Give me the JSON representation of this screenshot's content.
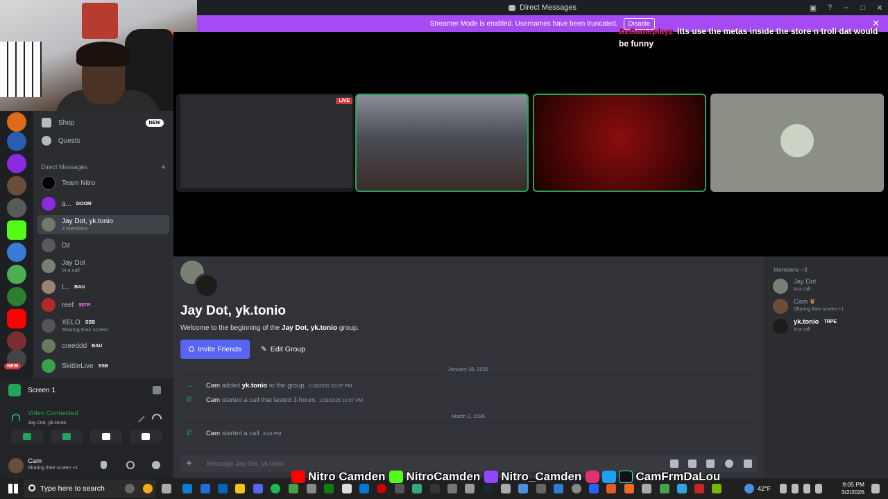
{
  "window": {
    "title": "Direct Messages"
  },
  "banner": {
    "text": "Streamer Mode is enabled. Usernames have been truncated.",
    "button": "Disable"
  },
  "stream_chat": {
    "user": "DzGameplayz",
    "message": "Itts use the metas inside the store n troll dat would be funny"
  },
  "sidebar": {
    "shop": "Shop",
    "shop_badge": "NEW",
    "quests": "Quests",
    "dm_header": "Direct Messages",
    "dms": [
      {
        "name": "Team Nitro",
        "sub": "",
        "tag": ""
      },
      {
        "name": "a...",
        "sub": "",
        "tag": "DOOM"
      },
      {
        "name": "Jay Dot, yk.tonio",
        "sub": "3 Members",
        "tag": ""
      },
      {
        "name": "Dz",
        "sub": "",
        "tag": ""
      },
      {
        "name": "Jay Dot",
        "sub": "In a call",
        "tag": ""
      },
      {
        "name": "t...",
        "sub": "",
        "tag": "BAU"
      },
      {
        "name": "reef",
        "sub": "",
        "tag": "$$TR"
      },
      {
        "name": "XELO",
        "sub": "Sharing their screen",
        "tag": "SSB"
      },
      {
        "name": "creeddd",
        "sub": "",
        "tag": "BAU"
      },
      {
        "name": "SkittleLive",
        "sub": "",
        "tag": "SSB"
      }
    ],
    "rail_badge": "NEW"
  },
  "panel": {
    "screen_label": "Screen 1",
    "vc_status": "Video Connected",
    "vc_channel": "Jay Dot, yk.tonio",
    "user_name": "Cam",
    "user_status": "Sharing their screen +1"
  },
  "call": {
    "live_badge": "LIVE"
  },
  "chat": {
    "group_title": "Jay Dot, yk.tonio",
    "welcome_prefix": "Welcome to the beginning of the ",
    "welcome_group": "Jay Dot, yk.tonio",
    "welcome_suffix": " group.",
    "invite_button": "Invite Friends",
    "edit_button": "Edit Group",
    "date1": "January 18, 2026",
    "msg1_user": "Cam",
    "msg1_text1": " added ",
    "msg1_target": "yk.tonio",
    "msg1_text2": " to the group.",
    "msg1_ts": "1/18/2026 10:07 PM",
    "msg2_user": "Cam",
    "msg2_text": " started a call that lasted 3 hours.",
    "msg2_ts": "1/18/2026 10:07 PM",
    "date2": "March 2, 2026",
    "msg3_user": "Cam",
    "msg3_text": " started a call.",
    "msg3_ts": "8:48 PM",
    "composer_placeholder": "Message Jay Dot, yk.tonio"
  },
  "members": {
    "header": "Members—3",
    "list": [
      {
        "name": "Jay Dot",
        "status": "In a call",
        "tag": ""
      },
      {
        "name": "Cam",
        "status": "Sharing their screen +1",
        "tag": ""
      },
      {
        "name": "yk.tonio",
        "status": "In a call",
        "tag": "TRPE"
      }
    ]
  },
  "socials": {
    "youtube": "Nitro Camden",
    "kick": "NitroCamden",
    "twitch": "Nitro_Camden",
    "instagram_twitter_tiktok": "CamFrmDaLou"
  },
  "taskbar": {
    "search": "Type here to search",
    "temperature": "42°F",
    "time": "9:05 PM",
    "date": "3/2/2026"
  },
  "colors": {
    "blurple": "#5865f2",
    "green": "#23a55a",
    "banner": "#a64bf4"
  }
}
